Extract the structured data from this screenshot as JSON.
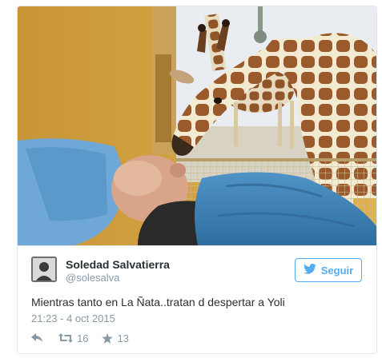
{
  "tweet": {
    "author_name": "Soledad Salvatierra",
    "author_handle": "@solesalva",
    "follow_label": "Seguir",
    "text": "Mientras tanto en La Ñata..tratan d despertar a Yoli",
    "timestamp": "21:23 - 4 oct 2015",
    "retweet_count": "16",
    "like_count": "13"
  },
  "icons": {
    "follow": "twitter-bird-icon",
    "reply": "reply-arrow-icon",
    "retweet": "retweet-icon",
    "like": "star-icon"
  },
  "colors": {
    "accent": "#55acee",
    "text": "#292f33",
    "muted": "#8899a6",
    "border": "#e1e8ed"
  }
}
